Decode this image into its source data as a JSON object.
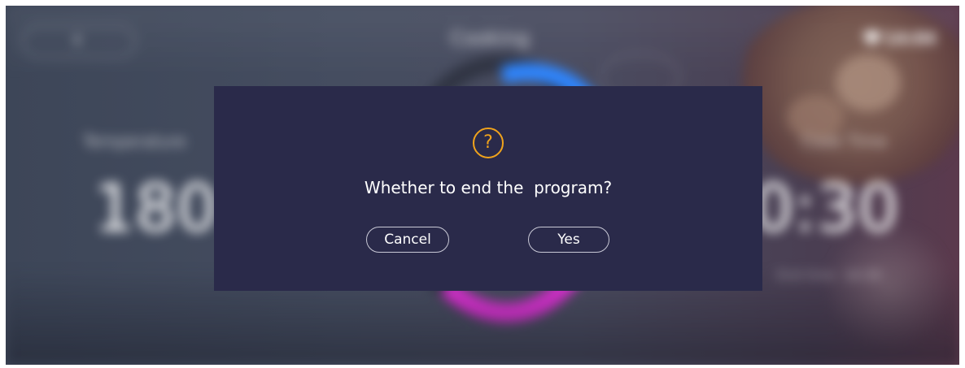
{
  "header": {
    "title": "Cooking",
    "time": "14:04"
  },
  "left_panel": {
    "label": "Temperature",
    "value": "180"
  },
  "right_panel": {
    "label": "Cook Time",
    "value": "0:30",
    "end_label": "End time",
    "end_value": "14:30"
  },
  "dialog": {
    "icon": "question-circle-icon",
    "message": "Whether to end the  program?",
    "cancel_label": "Cancel",
    "yes_label": "Yes"
  },
  "colors": {
    "dialog_background": "#2a2a4a",
    "question_icon": "#f0a31c",
    "progress_ring_blue": "#2f86ff",
    "progress_ring_magenta": "#e232d8"
  }
}
